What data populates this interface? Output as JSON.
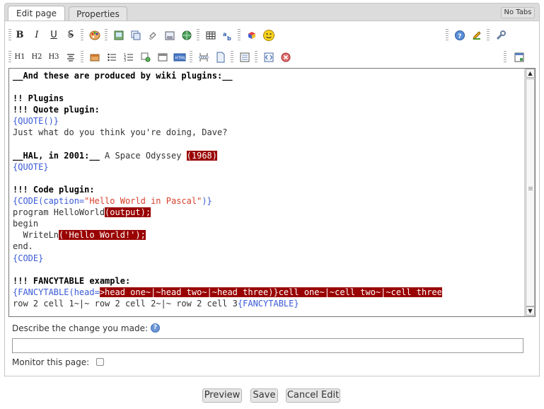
{
  "tabs": [
    {
      "label": "Edit page"
    },
    {
      "label": "Properties"
    }
  ],
  "no_tabs_label": "No Tabs",
  "toolbar1": {
    "bold": "B",
    "italic": "I",
    "underline": "U",
    "strike": "S",
    "icons": [
      "palette-icon",
      "image-icon",
      "copy-icon",
      "attach-icon",
      "disk-icon",
      "globe-icon",
      "table-icon",
      "sort-icon",
      "cube-icon",
      "smiley-icon",
      "help-icon",
      "pencil-icon",
      "wrench-icon"
    ]
  },
  "toolbar2": {
    "h1": "H1",
    "h2": "H2",
    "h3": "H3"
  },
  "editor": {
    "lines": [
      {
        "segments": [
          {
            "t": "__And these are produced by wiki plugins:__",
            "c": "b"
          }
        ]
      },
      {
        "segments": []
      },
      {
        "segments": [
          {
            "t": "!! Plugins",
            "c": "b"
          }
        ]
      },
      {
        "segments": [
          {
            "t": "!!! Quote plugin:",
            "c": "b"
          }
        ]
      },
      {
        "segments": [
          {
            "t": "{QUOTE()}",
            "c": "blue"
          }
        ]
      },
      {
        "segments": [
          {
            "t": "Just what do you think you're doing, Dave?",
            "c": ""
          }
        ]
      },
      {
        "segments": []
      },
      {
        "segments": [
          {
            "t": "__HAL, in 2001:__",
            "c": "b"
          },
          {
            "t": " A Space Odyssey ",
            "c": ""
          },
          {
            "t": "(1968)",
            "c": "hl"
          }
        ]
      },
      {
        "segments": [
          {
            "t": "{QUOTE}",
            "c": "blue"
          }
        ]
      },
      {
        "segments": []
      },
      {
        "segments": [
          {
            "t": "!!! Code plugin:",
            "c": "b"
          }
        ]
      },
      {
        "segments": [
          {
            "t": "{CODE(caption=",
            "c": "blue"
          },
          {
            "t": "\"Hello World in Pascal\"",
            "c": "red"
          },
          {
            "t": ")}",
            "c": "blue"
          }
        ]
      },
      {
        "segments": [
          {
            "t": "program HelloWorld",
            "c": ""
          },
          {
            "t": "(output);",
            "c": "hl"
          }
        ]
      },
      {
        "segments": [
          {
            "t": "begin",
            "c": ""
          }
        ]
      },
      {
        "segments": [
          {
            "t": "  WriteLn",
            "c": ""
          },
          {
            "t": "('Hello World!');",
            "c": "hl"
          }
        ]
      },
      {
        "segments": [
          {
            "t": "end.",
            "c": ""
          }
        ]
      },
      {
        "segments": [
          {
            "t": "{CODE}",
            "c": "blue"
          }
        ]
      },
      {
        "segments": []
      },
      {
        "segments": [
          {
            "t": "!!! FANCYTABLE example:",
            "c": "b"
          }
        ]
      },
      {
        "segments": [
          {
            "t": "{FANCYTABLE(head=",
            "c": "blue"
          },
          {
            "t": ">head one~|~head two~|~head three)}cell one~|~cell two~|~cell three",
            "c": "hl"
          }
        ]
      },
      {
        "segments": [
          {
            "t": "row 2 cell 1~|~ row 2 cell 2~|~ row 2 cell 3",
            "c": ""
          },
          {
            "t": "{FANCYTABLE}",
            "c": "blue"
          }
        ]
      }
    ]
  },
  "describe_label": "Describe the change you made:",
  "describe_value": "",
  "monitor_label": "Monitor this page:",
  "buttons": {
    "preview": "Preview",
    "save": "Save",
    "cancel": "Cancel Edit"
  }
}
